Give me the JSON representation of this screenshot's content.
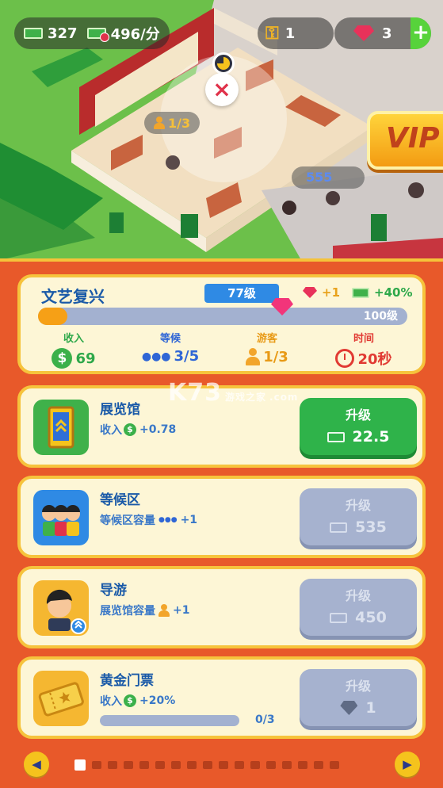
{
  "hud": {
    "cash": "327",
    "income_rate": "496/分",
    "keys": "1",
    "gems": "3",
    "plus_label": "+"
  },
  "scene": {
    "visitors": "1/3",
    "queue": "555",
    "close_symbol": "×",
    "vip_label": "VIP"
  },
  "era": {
    "title": "文艺复兴",
    "level": "77级",
    "gem_bonus": "+1",
    "cash_bonus": "+40%",
    "max_level": "100级",
    "progress": 0.08,
    "stats": [
      {
        "label": "收入",
        "value": "69",
        "color": "#2ea84a"
      },
      {
        "label": "等候",
        "value": "3/5",
        "color": "#2f66d6"
      },
      {
        "label": "游客",
        "value": "1/3",
        "color": "#e89a16"
      },
      {
        "label": "时间",
        "value": "20秒",
        "color": "#e13a33"
      }
    ]
  },
  "items": [
    {
      "title": "展览馆",
      "sub_prefix": "收入",
      "sub_value": "+0.78",
      "button": "升级",
      "cost": "22.5",
      "state": "active"
    },
    {
      "title": "等候区",
      "sub_prefix": "等候区容量",
      "sub_value": "+1",
      "button": "升级",
      "cost": "535",
      "state": "disabled"
    },
    {
      "title": "导游",
      "sub_prefix": "展览馆容量",
      "sub_value": "+1",
      "button": "升级",
      "cost": "450",
      "state": "disabled"
    },
    {
      "title": "黄金门票",
      "sub_prefix": "收入",
      "sub_value": "+20%",
      "button": "升级",
      "cost": "1",
      "state": "disabled",
      "progress_text": "0/3",
      "progress": 0
    }
  ],
  "pager": {
    "prev": "◀",
    "next": "▶",
    "pages": 17,
    "current": 0
  },
  "watermark": {
    "main": "K73",
    "sub": "游戏之家",
    "domain": ".com"
  }
}
